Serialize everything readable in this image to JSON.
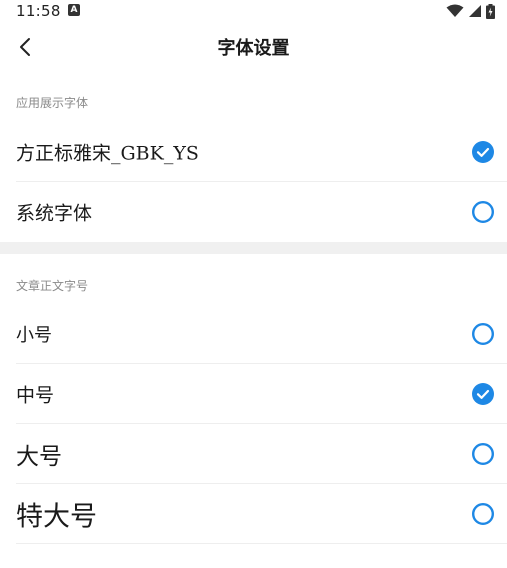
{
  "status_bar": {
    "time": "11:58",
    "notification_glyph": "A"
  },
  "nav": {
    "title": "字体设置"
  },
  "display_font_section": {
    "header": "应用展示字体",
    "options": [
      {
        "label": "方正标雅宋_GBK_YS",
        "selected": true
      },
      {
        "label": "系统字体",
        "selected": false
      }
    ]
  },
  "text_size_section": {
    "header": "文章正文字号",
    "options": [
      {
        "label": "小号",
        "selected": false
      },
      {
        "label": "中号",
        "selected": true
      },
      {
        "label": "大号",
        "selected": false
      },
      {
        "label": "特大号",
        "selected": false
      }
    ]
  },
  "colors": {
    "accent": "#1e88e5",
    "divider": "#eeeeee",
    "section_gap": "#f0f0f0",
    "header_text": "#8a8a8a"
  }
}
